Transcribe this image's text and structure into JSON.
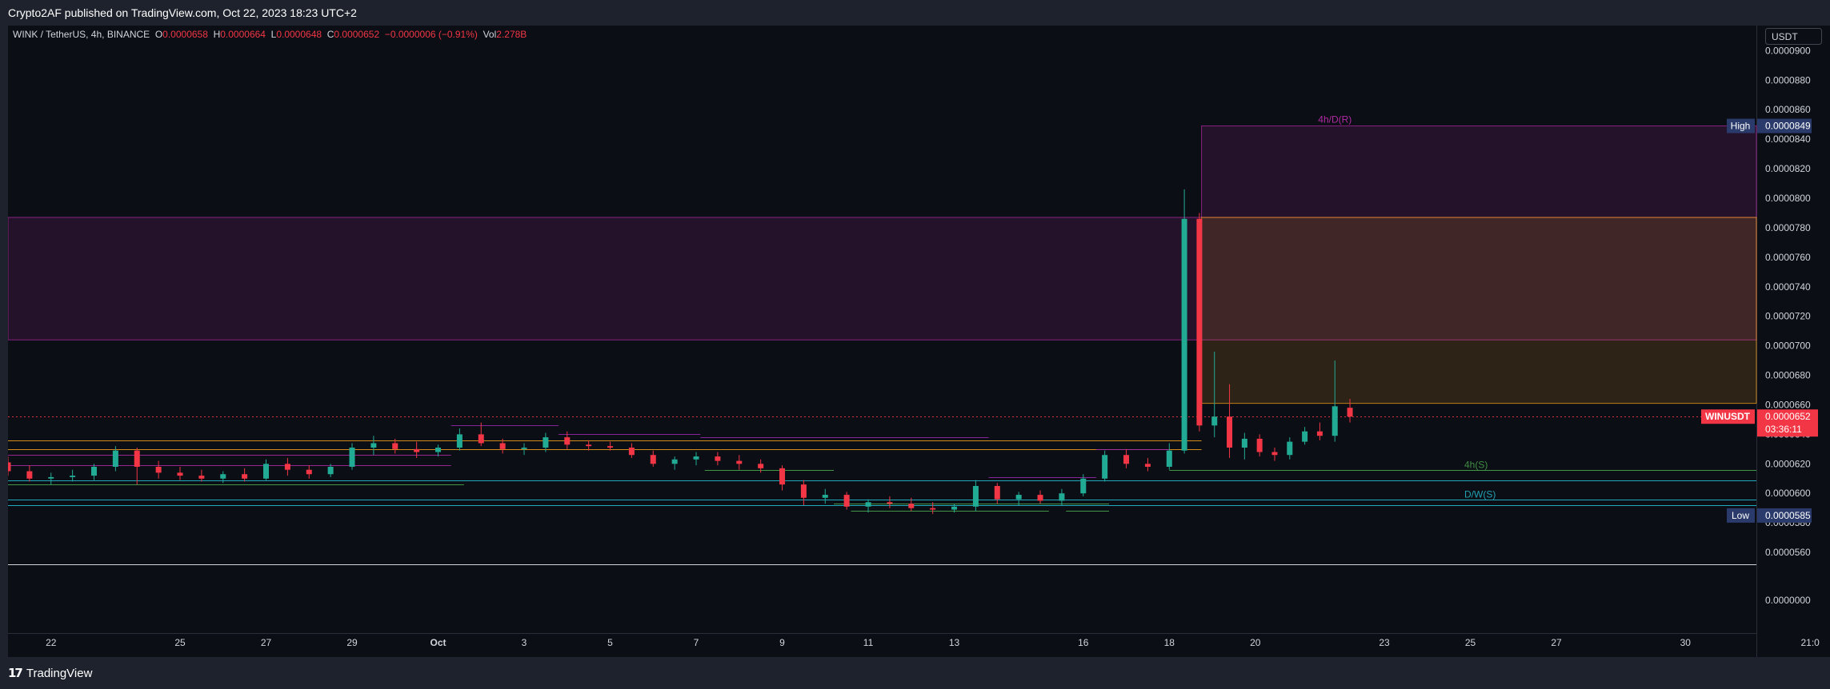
{
  "header": {
    "published_line": "Crypto2AF published on TradingView.com, Oct 22, 2023 18:23 UTC+2"
  },
  "footer": {
    "brand": "TradingView",
    "logo_icon": "tradingview-logo-icon"
  },
  "colors": {
    "up": "#089981",
    "up_bright": "#22ab94",
    "down": "#f23645",
    "orange": "#f7a21b",
    "magenta": "#b02aa3",
    "purple": "#9c27b0",
    "green_level": "#4caf50",
    "teal": "#26c6da",
    "axis_text": "#d1d4dc"
  },
  "chart_data": {
    "type": "candlestick",
    "symbol_line": {
      "name": "WINK / TetherUS, 4h, BINANCE",
      "o_label": "O",
      "o_value": "0.0000658",
      "h_label": "H",
      "h_value": "0.0000664",
      "l_label": "L",
      "l_value": "0.0000648",
      "c_label": "C",
      "c_value": "0.0000652",
      "change": "−0.0000006 (−0.91%)",
      "vol_label": "Vol",
      "vol_value": "2.278B"
    },
    "currency": "USDT",
    "y_ticks": [
      "0.0000900",
      "0.0000880",
      "0.0000860",
      "0.0000840",
      "0.0000820",
      "0.0000800",
      "0.0000780",
      "0.0000760",
      "0.0000740",
      "0.0000720",
      "0.0000700",
      "0.0000680",
      "0.0000660",
      "0.0000640",
      "0.0000620",
      "0.0000600",
      "0.0000580",
      "0.0000560"
    ],
    "y_tick_values": [
      90,
      88,
      86,
      84,
      82,
      80,
      78,
      76,
      74,
      72,
      70,
      68,
      66,
      64,
      62,
      60,
      58,
      56
    ],
    "volume_axis_tick": "0.0000000",
    "x_ticks": [
      "22",
      "25",
      "27",
      "29",
      "Oct",
      "3",
      "5",
      "7",
      "9",
      "11",
      "13",
      "16",
      "18",
      "20",
      "23",
      "25",
      "27",
      "30",
      "21:0"
    ],
    "x_tick_positions_day": [
      -8,
      -5,
      -3,
      -1,
      1,
      3,
      5,
      7,
      9,
      11,
      13,
      16,
      18,
      20,
      23,
      25,
      27,
      30,
      32.9
    ],
    "ylim": [
      55.3,
      91.7
    ],
    "xlim_day": [
      -9.0,
      31.65
    ],
    "value_unit_note": "prices ×1e-7 USDT",
    "last_price": {
      "symbol": "WINUSDT",
      "value": "0.0000652",
      "countdown": "03:36:11",
      "y": 65.2
    },
    "high_marker": {
      "label": "High",
      "value": "0.0000849",
      "y": 84.9
    },
    "low_marker": {
      "label": "Low",
      "value": "0.0000585",
      "y": 58.5
    },
    "zones": [
      {
        "x0": -9.0,
        "x1": 31.65,
        "y0": 70.4,
        "y1": 78.7,
        "fill": "#b02aa3",
        "label": ""
      },
      {
        "x0": 18.75,
        "x1": 31.65,
        "y0": 78.7,
        "y1": 84.9,
        "fill": "#b02aa3",
        "label": "4h/D(R)"
      },
      {
        "x0": 18.75,
        "x1": 31.65,
        "y0": 66.1,
        "y1": 78.7,
        "fill": "#f7a21b",
        "label": ""
      }
    ],
    "levels": [
      {
        "x0": -9.0,
        "x1": 31.65,
        "y": 65.2,
        "color": "#f23645",
        "dashed": true,
        "label": ""
      },
      {
        "x0": 18.0,
        "x1": 31.65,
        "y": 61.6,
        "color": "#4caf50",
        "label": "4h(S)"
      },
      {
        "x0": -9.0,
        "x1": 31.65,
        "y": 60.9,
        "color": "#26c6da",
        "label": ""
      },
      {
        "x0": -9.0,
        "x1": 31.65,
        "y": 59.6,
        "color": "#26c6da",
        "label": "D/W(S)"
      },
      {
        "x0": -9.0,
        "x1": 31.65,
        "y": 59.2,
        "color": "#26c6da",
        "label": ""
      },
      {
        "x0": -9.0,
        "x1": 18.75,
        "y": 63.6,
        "color": "#f7a21b",
        "label": ""
      },
      {
        "x0": -9.0,
        "x1": 18.75,
        "y": 63.0,
        "color": "#f7a21b",
        "label": ""
      },
      {
        "x0": -9.0,
        "x1": 1.3,
        "y": 62.6,
        "color": "#b02aa3",
        "label": ""
      },
      {
        "x0": -9.0,
        "x1": 1.3,
        "y": 61.9,
        "color": "#b02aa3",
        "label": ""
      },
      {
        "x0": 1.3,
        "x1": 3.8,
        "y": 64.6,
        "color": "#9c27b0",
        "label": ""
      },
      {
        "x0": 3.8,
        "x1": 7.1,
        "y": 64.0,
        "color": "#9c27b0",
        "label": ""
      },
      {
        "x0": 7.1,
        "x1": 13.8,
        "y": 63.8,
        "color": "#9c27b0",
        "label": ""
      },
      {
        "x0": 13.8,
        "x1": 16.3,
        "y": 61.1,
        "color": "#9c27b0",
        "label": ""
      },
      {
        "x0": 16.3,
        "x1": 18.0,
        "y": 63.0,
        "color": "#9c27b0",
        "label": ""
      },
      {
        "x0": -9.0,
        "x1": 1.6,
        "y": 60.6,
        "color": "#4caf50",
        "label": ""
      },
      {
        "x0": 7.2,
        "x1": 10.2,
        "y": 61.6,
        "color": "#4caf50",
        "label": ""
      },
      {
        "x0": 10.2,
        "x1": 16.6,
        "y": 59.3,
        "color": "#4caf50",
        "label": ""
      },
      {
        "x0": 10.6,
        "x1": 15.2,
        "y": 58.8,
        "color": "#4caf50",
        "label": ""
      },
      {
        "x0": 15.6,
        "x1": 16.6,
        "y": 58.8,
        "color": "#4caf50",
        "label": ""
      }
    ],
    "candles": [
      {
        "t": -9.0,
        "o": 62.1,
        "h": 62.5,
        "l": 61.2,
        "c": 61.5
      },
      {
        "t": -8.5,
        "o": 61.5,
        "h": 61.9,
        "l": 60.8,
        "c": 61.0
      },
      {
        "t": -8.0,
        "o": 61.0,
        "h": 61.4,
        "l": 60.6,
        "c": 61.1
      },
      {
        "t": -7.5,
        "o": 61.1,
        "h": 61.6,
        "l": 60.8,
        "c": 61.2
      },
      {
        "t": -7.0,
        "o": 61.2,
        "h": 62.0,
        "l": 60.9,
        "c": 61.8
      },
      {
        "t": -6.5,
        "o": 61.8,
        "h": 63.2,
        "l": 61.5,
        "c": 62.9
      },
      {
        "t": -6.0,
        "o": 62.9,
        "h": 63.1,
        "l": 60.6,
        "c": 61.8
      },
      {
        "t": -5.5,
        "o": 61.8,
        "h": 62.2,
        "l": 61.0,
        "c": 61.4
      },
      {
        "t": -5.0,
        "o": 61.4,
        "h": 61.8,
        "l": 60.9,
        "c": 61.2
      },
      {
        "t": -4.5,
        "o": 61.2,
        "h": 61.6,
        "l": 60.8,
        "c": 61.0
      },
      {
        "t": -4.0,
        "o": 61.0,
        "h": 61.5,
        "l": 60.7,
        "c": 61.3
      },
      {
        "t": -3.5,
        "o": 61.3,
        "h": 61.7,
        "l": 60.8,
        "c": 61.0
      },
      {
        "t": -3.0,
        "o": 61.0,
        "h": 62.3,
        "l": 60.9,
        "c": 62.0
      },
      {
        "t": -2.5,
        "o": 62.0,
        "h": 62.4,
        "l": 61.2,
        "c": 61.6
      },
      {
        "t": -2.0,
        "o": 61.6,
        "h": 61.9,
        "l": 61.0,
        "c": 61.3
      },
      {
        "t": -1.5,
        "o": 61.3,
        "h": 62.0,
        "l": 61.1,
        "c": 61.8
      },
      {
        "t": -1.0,
        "o": 61.8,
        "h": 63.4,
        "l": 61.6,
        "c": 63.1
      },
      {
        "t": -0.5,
        "o": 63.1,
        "h": 63.9,
        "l": 62.6,
        "c": 63.4
      },
      {
        "t": 0.0,
        "o": 63.4,
        "h": 63.7,
        "l": 62.7,
        "c": 63.0
      },
      {
        "t": 0.5,
        "o": 63.0,
        "h": 63.5,
        "l": 62.4,
        "c": 62.8
      },
      {
        "t": 1.0,
        "o": 62.8,
        "h": 63.3,
        "l": 62.5,
        "c": 63.1
      },
      {
        "t": 1.5,
        "o": 63.1,
        "h": 64.4,
        "l": 62.9,
        "c": 64.0
      },
      {
        "t": 2.0,
        "o": 64.0,
        "h": 64.8,
        "l": 63.2,
        "c": 63.4
      },
      {
        "t": 2.5,
        "o": 63.4,
        "h": 63.7,
        "l": 62.7,
        "c": 63.0
      },
      {
        "t": 3.0,
        "o": 63.0,
        "h": 63.4,
        "l": 62.6,
        "c": 63.1
      },
      {
        "t": 3.5,
        "o": 63.1,
        "h": 64.1,
        "l": 62.8,
        "c": 63.8
      },
      {
        "t": 4.0,
        "o": 63.8,
        "h": 64.2,
        "l": 63.0,
        "c": 63.3
      },
      {
        "t": 4.5,
        "o": 63.3,
        "h": 63.6,
        "l": 62.9,
        "c": 63.2
      },
      {
        "t": 5.0,
        "o": 63.2,
        "h": 63.5,
        "l": 62.9,
        "c": 63.1
      },
      {
        "t": 5.5,
        "o": 63.1,
        "h": 63.4,
        "l": 62.4,
        "c": 62.6
      },
      {
        "t": 6.0,
        "o": 62.6,
        "h": 62.9,
        "l": 61.8,
        "c": 62.0
      },
      {
        "t": 6.5,
        "o": 62.0,
        "h": 62.5,
        "l": 61.6,
        "c": 62.3
      },
      {
        "t": 7.0,
        "o": 62.3,
        "h": 62.8,
        "l": 61.9,
        "c": 62.5
      },
      {
        "t": 7.5,
        "o": 62.5,
        "h": 62.8,
        "l": 61.9,
        "c": 62.2
      },
      {
        "t": 8.0,
        "o": 62.2,
        "h": 62.6,
        "l": 61.6,
        "c": 62.0
      },
      {
        "t": 8.5,
        "o": 62.0,
        "h": 62.3,
        "l": 61.4,
        "c": 61.7
      },
      {
        "t": 9.0,
        "o": 61.7,
        "h": 61.9,
        "l": 60.2,
        "c": 60.6
      },
      {
        "t": 9.5,
        "o": 60.6,
        "h": 60.9,
        "l": 59.2,
        "c": 59.7
      },
      {
        "t": 10.0,
        "o": 59.7,
        "h": 60.3,
        "l": 59.3,
        "c": 59.9
      },
      {
        "t": 10.5,
        "o": 59.9,
        "h": 60.1,
        "l": 58.9,
        "c": 59.1
      },
      {
        "t": 11.0,
        "o": 59.1,
        "h": 59.6,
        "l": 58.7,
        "c": 59.4
      },
      {
        "t": 11.5,
        "o": 59.4,
        "h": 59.8,
        "l": 59.0,
        "c": 59.3
      },
      {
        "t": 12.0,
        "o": 59.3,
        "h": 59.7,
        "l": 58.8,
        "c": 59.0
      },
      {
        "t": 12.5,
        "o": 59.0,
        "h": 59.4,
        "l": 58.6,
        "c": 58.9
      },
      {
        "t": 13.0,
        "o": 58.9,
        "h": 59.3,
        "l": 58.7,
        "c": 59.1
      },
      {
        "t": 13.5,
        "o": 59.1,
        "h": 60.9,
        "l": 58.8,
        "c": 60.5
      },
      {
        "t": 14.0,
        "o": 60.5,
        "h": 60.7,
        "l": 59.3,
        "c": 59.6
      },
      {
        "t": 14.5,
        "o": 59.6,
        "h": 60.1,
        "l": 59.2,
        "c": 59.9
      },
      {
        "t": 15.0,
        "o": 59.9,
        "h": 60.2,
        "l": 59.3,
        "c": 59.5
      },
      {
        "t": 15.5,
        "o": 59.5,
        "h": 60.3,
        "l": 59.2,
        "c": 60.0
      },
      {
        "t": 16.0,
        "o": 60.0,
        "h": 61.3,
        "l": 59.8,
        "c": 61.0
      },
      {
        "t": 16.5,
        "o": 61.0,
        "h": 62.9,
        "l": 60.8,
        "c": 62.6
      },
      {
        "t": 17.0,
        "o": 62.6,
        "h": 63.0,
        "l": 61.7,
        "c": 62.0
      },
      {
        "t": 17.5,
        "o": 62.0,
        "h": 62.4,
        "l": 61.5,
        "c": 61.8
      },
      {
        "t": 18.0,
        "o": 61.8,
        "h": 63.4,
        "l": 61.6,
        "c": 62.9
      },
      {
        "t": 18.35,
        "o": 62.9,
        "h": 80.6,
        "l": 62.7,
        "c": 78.6
      },
      {
        "t": 18.7,
        "o": 78.6,
        "h": 79.0,
        "l": 64.2,
        "c": 64.6
      },
      {
        "t": 19.05,
        "o": 64.6,
        "h": 69.6,
        "l": 63.8,
        "c": 65.2
      },
      {
        "t": 19.4,
        "o": 65.2,
        "h": 67.4,
        "l": 62.4,
        "c": 63.1
      },
      {
        "t": 19.75,
        "o": 63.1,
        "h": 64.1,
        "l": 62.3,
        "c": 63.7
      },
      {
        "t": 20.1,
        "o": 63.7,
        "h": 64.0,
        "l": 62.5,
        "c": 62.8
      },
      {
        "t": 20.45,
        "o": 62.8,
        "h": 63.1,
        "l": 62.2,
        "c": 62.6
      },
      {
        "t": 20.8,
        "o": 62.6,
        "h": 63.8,
        "l": 62.3,
        "c": 63.5
      },
      {
        "t": 21.15,
        "o": 63.5,
        "h": 64.5,
        "l": 63.3,
        "c": 64.2
      },
      {
        "t": 21.5,
        "o": 64.2,
        "h": 64.8,
        "l": 63.6,
        "c": 63.9
      },
      {
        "t": 21.85,
        "o": 63.9,
        "h": 69.0,
        "l": 63.5,
        "c": 65.9
      },
      {
        "t": 22.2,
        "o": 65.8,
        "h": 66.4,
        "l": 64.8,
        "c": 65.2
      }
    ]
  }
}
